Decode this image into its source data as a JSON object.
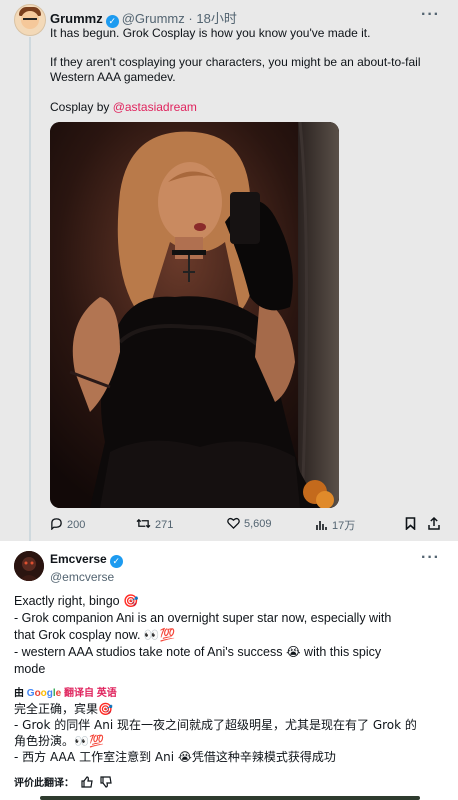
{
  "tweet1": {
    "name": "Grummz",
    "handle": "@Grummz",
    "separator": "·",
    "time": "18小时",
    "line1": "It has begun. Grok Cosplay is how you know you've made it.",
    "line2a": "If they aren't cosplaying your characters, you might be an about-to-fail",
    "line2b": "Western AAA gamedev.",
    "credit_prefix": "Cosplay by ",
    "credit_link": "@astasiadream",
    "target_emoji": "🎯",
    "more": "···",
    "actions": {
      "replies": "200",
      "reposts": "271",
      "likes": "5,609",
      "views": "17万"
    }
  },
  "tweet2": {
    "name": "Emcverse",
    "handle": "@emcverse",
    "more": "···",
    "lines": [
      "Exactly right, bingo 🎯",
      "- Grok companion Ani is an overnight super star now, especially with",
      "that Grok cosplay now. 👀💯",
      "- western AAA studios take note of Ani's success 😭 with this spicy",
      "mode"
    ],
    "translate": {
      "by": "由",
      "google": "Google",
      "label": "翻译自 英语"
    },
    "translated": [
      "完全正确，宾果🎯",
      "- Grok 的同伴 Ani 现在一夜之间就成了超级明星，尤其是现在有了 Grok 的",
      "角色扮演。👀💯",
      "- 西方 AAA 工作室注意到 Ani 😭凭借这种辛辣模式获得成功"
    ],
    "rate_label": "评价此翻译："
  },
  "colors": {
    "verified": "#1d9bf0",
    "link": "#e0245e",
    "muted": "#536471"
  }
}
